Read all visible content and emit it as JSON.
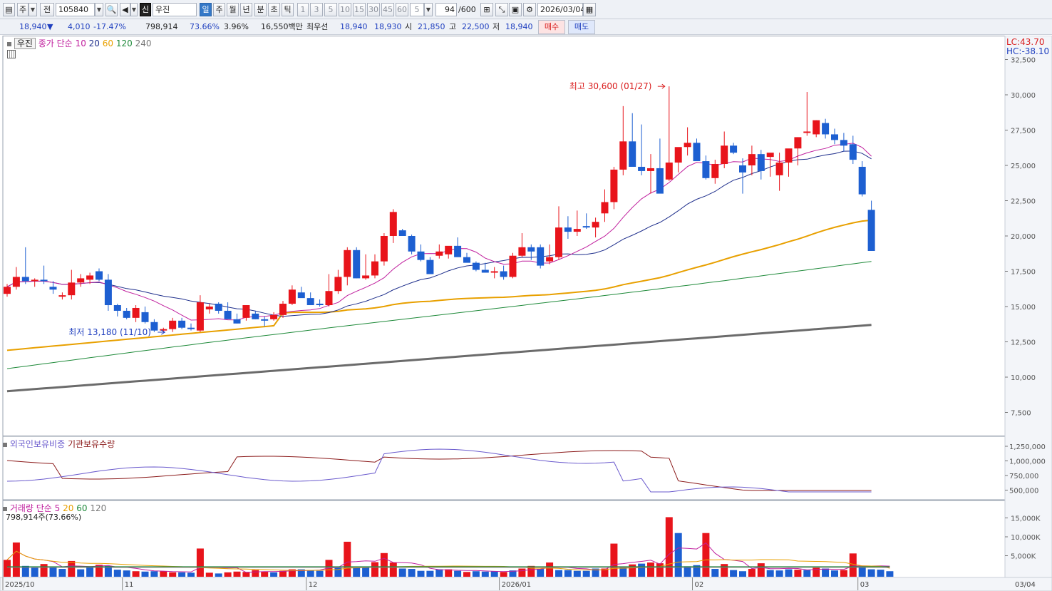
{
  "toolbar": {
    "period_type": "주",
    "prev_label": "전",
    "stock_code": "105840",
    "new_badge": "신",
    "stock_name": "우진",
    "periods": [
      "일",
      "주",
      "월",
      "년",
      "분",
      "초",
      "틱"
    ],
    "selected_period": "일",
    "minute_buttons": [
      "1",
      "3",
      "5",
      "10",
      "15",
      "30",
      "45",
      "60"
    ],
    "interval_value": "5",
    "count": "94",
    "count_total": "/600",
    "date": "2026/03/04"
  },
  "quote": {
    "price": "18,940",
    "change_arrow": "▼",
    "change": "4,010",
    "change_pct": "-17.47%",
    "volume": "798,914",
    "volume_ratio": "73.66%",
    "turnover": "3.96%",
    "amount": "16,550백만",
    "best_ask_label": "최우선",
    "best_ask": "18,940",
    "best_bid": "18,930",
    "open_label": "시",
    "open": "21,850",
    "high_label": "고",
    "high": "22,500",
    "low_label": "저",
    "low": "18,940",
    "buy_label": "매수",
    "sell_label": "매도"
  },
  "price_panel": {
    "name_tag": "우진",
    "legend_prefix": "종가 단순",
    "ma_labels": [
      {
        "label": "10",
        "color": "#c0209e"
      },
      {
        "label": "20",
        "color": "#1f2f8c"
      },
      {
        "label": "60",
        "color": "#e8a000"
      },
      {
        "label": "120",
        "color": "#1f8a3a"
      },
      {
        "label": "240",
        "color": "#777777"
      }
    ],
    "lc_label": "LC:43.70",
    "hc_label": "HC:-38.10",
    "max_annotation": "최고 30,600 (01/27)",
    "min_annotation": "최저 13,180 (11/10)",
    "y_ticks": [
      "32,500",
      "30,000",
      "27,500",
      "25,000",
      "22,500",
      "20,000",
      "17,500",
      "15,000",
      "12,500",
      "10,000",
      "7,500"
    ]
  },
  "holding_panel": {
    "legend_a": "외국인보유비중",
    "legend_b": "기관보유수량",
    "y_ticks": [
      "1,250,000",
      "1,000,000",
      "750,000",
      "500,000"
    ]
  },
  "volume_panel": {
    "legend_prefix": "거래량 단순",
    "ma_labels": [
      {
        "label": "5",
        "color": "#c0209e"
      },
      {
        "label": "20",
        "color": "#e8a000"
      },
      {
        "label": "60",
        "color": "#1f8a3a"
      },
      {
        "label": "120",
        "color": "#777777"
      }
    ],
    "current": "798,914주(73.66%)",
    "y_ticks": [
      "15,000K",
      "10,000K",
      "5,000K"
    ]
  },
  "x_axis": {
    "labels": [
      "2025/10",
      "11",
      "12",
      "2026/01",
      "02",
      "03"
    ],
    "right_label": "03/04"
  },
  "colors": {
    "up": "#e8141b",
    "down": "#1d5fd1"
  },
  "chart_data": {
    "type": "candlestick",
    "candles": [
      [
        15900,
        16600,
        15700,
        16400
      ],
      [
        16400,
        17800,
        16200,
        17100
      ],
      [
        17100,
        19200,
        16600,
        16800
      ],
      [
        16800,
        17000,
        16400,
        16900
      ],
      [
        16900,
        17900,
        16600,
        16800
      ],
      [
        16400,
        16800,
        15900,
        16200
      ],
      [
        15700,
        16000,
        15500,
        15800
      ],
      [
        15800,
        17600,
        15500,
        16700
      ],
      [
        16700,
        17300,
        16400,
        17000
      ],
      [
        16900,
        17400,
        16600,
        17200
      ],
      [
        17500,
        17700,
        16800,
        16900
      ],
      [
        16900,
        17300,
        14700,
        15100
      ],
      [
        15100,
        15200,
        14300,
        14700
      ],
      [
        14700,
        14900,
        14100,
        14200
      ],
      [
        14200,
        15100,
        13900,
        14900
      ],
      [
        14600,
        15000,
        13800,
        13900
      ],
      [
        13900,
        14100,
        13200,
        13300
      ],
      [
        13300,
        13500,
        13200,
        13400
      ],
      [
        13400,
        14200,
        13200,
        14000
      ],
      [
        14000,
        14200,
        13400,
        13500
      ],
      [
        13500,
        13800,
        13300,
        13400
      ],
      [
        13300,
        15800,
        13200,
        15300
      ],
      [
        14800,
        15200,
        14500,
        15000
      ],
      [
        15200,
        15300,
        14500,
        14700
      ],
      [
        14700,
        15300,
        14400,
        14100
      ],
      [
        14100,
        14500,
        13800,
        13800
      ],
      [
        14200,
        15100,
        14000,
        15100
      ],
      [
        14500,
        14700,
        14100,
        14100
      ],
      [
        14100,
        14300,
        13600,
        14000
      ],
      [
        14100,
        14600,
        14000,
        14400
      ],
      [
        14400,
        15400,
        14200,
        15200
      ],
      [
        15200,
        16500,
        15100,
        16200
      ],
      [
        16000,
        16400,
        15700,
        15600
      ],
      [
        15600,
        16000,
        15100,
        15100
      ],
      [
        15200,
        15500,
        15000,
        15100
      ],
      [
        15100,
        17300,
        15000,
        16100
      ],
      [
        16100,
        17600,
        15900,
        17100
      ],
      [
        17100,
        19200,
        16500,
        19000
      ],
      [
        19000,
        19200,
        17000,
        17000
      ],
      [
        17000,
        18700,
        16900,
        17200
      ],
      [
        17200,
        18700,
        17000,
        18200
      ],
      [
        18200,
        20200,
        17900,
        20000
      ],
      [
        20000,
        21900,
        19500,
        21700
      ],
      [
        20400,
        20500,
        20000,
        20000
      ],
      [
        20000,
        20100,
        18700,
        18900
      ],
      [
        18900,
        19400,
        18200,
        18300
      ],
      [
        18300,
        18500,
        17700,
        17300
      ],
      [
        18600,
        19400,
        18400,
        18900
      ],
      [
        18700,
        19100,
        18400,
        19300
      ],
      [
        19300,
        19900,
        18700,
        18500
      ],
      [
        18500,
        18800,
        18200,
        18100
      ],
      [
        18100,
        18200,
        17500,
        17600
      ],
      [
        17600,
        18100,
        17500,
        17400
      ],
      [
        17400,
        17800,
        17000,
        17500
      ],
      [
        17500,
        17900,
        16900,
        17100
      ],
      [
        17100,
        18800,
        17000,
        18600
      ],
      [
        18600,
        20200,
        18500,
        19200
      ],
      [
        19200,
        19400,
        18300,
        18900
      ],
      [
        19200,
        19400,
        17700,
        17900
      ],
      [
        18200,
        19400,
        18000,
        18500
      ],
      [
        18500,
        22100,
        18300,
        20600
      ],
      [
        20600,
        21400,
        19800,
        20300
      ],
      [
        20300,
        21800,
        20000,
        20500
      ],
      [
        20700,
        21600,
        20500,
        20600
      ],
      [
        20600,
        21300,
        19900,
        21000
      ],
      [
        21600,
        23300,
        21000,
        22400
      ],
      [
        22400,
        24900,
        21900,
        24700
      ],
      [
        24700,
        29200,
        24300,
        26700
      ],
      [
        26700,
        28700,
        25000,
        24900
      ],
      [
        24900,
        27900,
        24300,
        24600
      ],
      [
        24600,
        25800,
        23000,
        24800
      ],
      [
        24800,
        26900,
        24400,
        23000
      ],
      [
        24000,
        30600,
        23900,
        25200
      ],
      [
        25200,
        25500,
        24500,
        26300
      ],
      [
        26300,
        27700,
        25700,
        26600
      ],
      [
        26600,
        26900,
        25300,
        25300
      ],
      [
        25300,
        25700,
        24000,
        24100
      ],
      [
        24100,
        25400,
        23700,
        25100
      ],
      [
        25100,
        27400,
        24800,
        26400
      ],
      [
        26400,
        26600,
        25800,
        25900
      ],
      [
        25000,
        25500,
        23000,
        24500
      ],
      [
        25000,
        26400,
        24300,
        25800
      ],
      [
        25800,
        26100,
        24000,
        24600
      ],
      [
        25600,
        25800,
        24200,
        25900
      ],
      [
        24300,
        25900,
        23200,
        25200
      ],
      [
        25200,
        25800,
        24200,
        26200
      ],
      [
        26200,
        27000,
        25000,
        27000
      ],
      [
        27300,
        30200,
        27100,
        27400
      ],
      [
        27200,
        28200,
        27000,
        28200
      ],
      [
        28000,
        28300,
        26900,
        27200
      ],
      [
        27200,
        27600,
        26500,
        26800
      ],
      [
        26800,
        27300,
        26000,
        26400
      ],
      [
        26500,
        27100,
        25100,
        25400
      ],
      [
        24900,
        25300,
        22800,
        22950
      ],
      [
        21850,
        22500,
        18940,
        18940
      ]
    ],
    "volume": [
      [
        3.9,
        1
      ],
      [
        8.5,
        1
      ],
      [
        2.3,
        0
      ],
      [
        1.8,
        0
      ],
      [
        2.8,
        1
      ],
      [
        1.9,
        0
      ],
      [
        1.5,
        0
      ],
      [
        3.6,
        1
      ],
      [
        1.4,
        0
      ],
      [
        2.2,
        0
      ],
      [
        2.6,
        1
      ],
      [
        2.3,
        0
      ],
      [
        1.3,
        0
      ],
      [
        1.1,
        0
      ],
      [
        0.9,
        1
      ],
      [
        0.8,
        0
      ],
      [
        0.9,
        0
      ],
      [
        0.9,
        1
      ],
      [
        0.6,
        1
      ],
      [
        0.6,
        0
      ],
      [
        0.5,
        0
      ],
      [
        6.9,
        1
      ],
      [
        0.5,
        1
      ],
      [
        0.3,
        0
      ],
      [
        0.6,
        1
      ],
      [
        0.8,
        1
      ],
      [
        0.7,
        1
      ],
      [
        1.2,
        1
      ],
      [
        0.8,
        1
      ],
      [
        0.6,
        0
      ],
      [
        1.0,
        1
      ],
      [
        1.4,
        1
      ],
      [
        1.4,
        0
      ],
      [
        1.2,
        0
      ],
      [
        1.0,
        0
      ],
      [
        3.9,
        1
      ],
      [
        1.8,
        0
      ],
      [
        8.7,
        1
      ],
      [
        1.8,
        0
      ],
      [
        2.0,
        0
      ],
      [
        3.3,
        1
      ],
      [
        5.7,
        1
      ],
      [
        3.2,
        1
      ],
      [
        1.6,
        0
      ],
      [
        1.5,
        0
      ],
      [
        1.0,
        0
      ],
      [
        1.0,
        0
      ],
      [
        1.4,
        0
      ],
      [
        1.4,
        1
      ],
      [
        1.0,
        0
      ],
      [
        0.7,
        1
      ],
      [
        0.9,
        0
      ],
      [
        0.8,
        0
      ],
      [
        0.9,
        0
      ],
      [
        0.7,
        1
      ],
      [
        1.1,
        0
      ],
      [
        1.6,
        1
      ],
      [
        2.3,
        1
      ],
      [
        1.5,
        0
      ],
      [
        3.2,
        1
      ],
      [
        1.2,
        0
      ],
      [
        1.2,
        0
      ],
      [
        1.0,
        0
      ],
      [
        1.0,
        0
      ],
      [
        1.6,
        0
      ],
      [
        1.6,
        1
      ],
      [
        8.2,
        1
      ],
      [
        2.1,
        0
      ],
      [
        2.7,
        1
      ],
      [
        2.9,
        0
      ],
      [
        3.2,
        1
      ],
      [
        3.0,
        1
      ],
      [
        15.2,
        1
      ],
      [
        11.0,
        0
      ],
      [
        2.2,
        0
      ],
      [
        2.5,
        0
      ],
      [
        11.0,
        1
      ],
      [
        1.5,
        0
      ],
      [
        2.8,
        1
      ],
      [
        1.2,
        0
      ],
      [
        0.9,
        0
      ],
      [
        1.5,
        1
      ],
      [
        3.0,
        1
      ],
      [
        1.2,
        0
      ],
      [
        1.1,
        0
      ],
      [
        1.4,
        0
      ],
      [
        1.3,
        1
      ],
      [
        1.2,
        0
      ],
      [
        1.8,
        1
      ],
      [
        1.6,
        0
      ],
      [
        1.1,
        0
      ],
      [
        1.2,
        1
      ],
      [
        5.6,
        1
      ],
      [
        2.0,
        0
      ],
      [
        1.4,
        0
      ],
      [
        1.3,
        0
      ],
      [
        0.9,
        0
      ]
    ]
  }
}
